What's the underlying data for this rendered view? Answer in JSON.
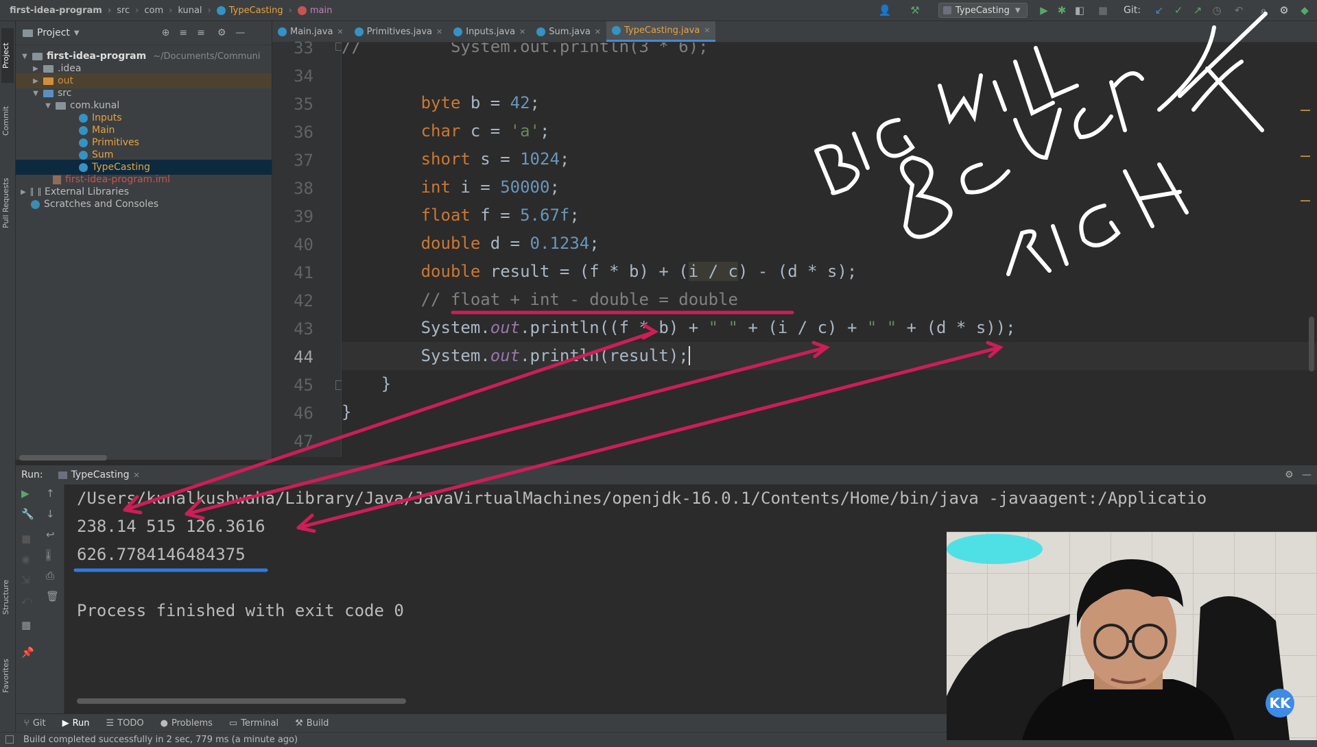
{
  "navbar": {
    "breadcrumbs": [
      "first-idea-program",
      "src",
      "com",
      "kunal",
      "TypeCasting",
      "main"
    ],
    "run_config": "TypeCasting",
    "git_label": "Git:"
  },
  "project_panel": {
    "title": "Project",
    "root_path": "~/Documents/Communi",
    "tree": {
      "root": "first-idea-program",
      "idea": ".idea",
      "out": "out",
      "src": "src",
      "pkg": "com.kunal",
      "files": [
        "Inputs",
        "Main",
        "Primitives",
        "Sum",
        "TypeCasting"
      ],
      "iml": "first-idea-program.iml",
      "ext": "External Libraries",
      "scratches": "Scratches and Consoles"
    }
  },
  "left_strip": {
    "project": "Project",
    "commit": "Commit",
    "pull": "Pull Requests",
    "structure": "Structure",
    "favorites": "Favorites"
  },
  "editor": {
    "tabs": [
      "Main.java",
      "Primitives.java",
      "Inputs.java",
      "Sum.java",
      "TypeCasting.java"
    ],
    "active_tab": "TypeCasting.java",
    "inspections": {
      "warnings": "3",
      "weak": "1"
    },
    "line_numbers": [
      "33",
      "34",
      "35",
      "36",
      "37",
      "38",
      "39",
      "40",
      "41",
      "42",
      "43",
      "44",
      "45",
      "46",
      "47"
    ],
    "current_line": "44"
  },
  "run_panel": {
    "label": "Run:",
    "tab": "TypeCasting",
    "console": [
      "/Users/kunalkushwaha/Library/Java/JavaVirtualMachines/openjdk-16.0.1/Contents/Home/bin/java -javaagent:/Applicatio",
      "238.14 515 126.3616",
      "626.7784146484375",
      "",
      "Process finished with exit code 0"
    ]
  },
  "bottom_tabs": [
    "Git",
    "Run",
    "TODO",
    "Problems",
    "Terminal",
    "Build"
  ],
  "status": "Build completed successfully in 2 sec, 779 ms (a minute ago)",
  "webcam": {
    "badge": "KK"
  },
  "annotations": {
    "handwriting_lines": [
      "BIG WILL",
      "Be over",
      "RIGHT"
    ]
  }
}
